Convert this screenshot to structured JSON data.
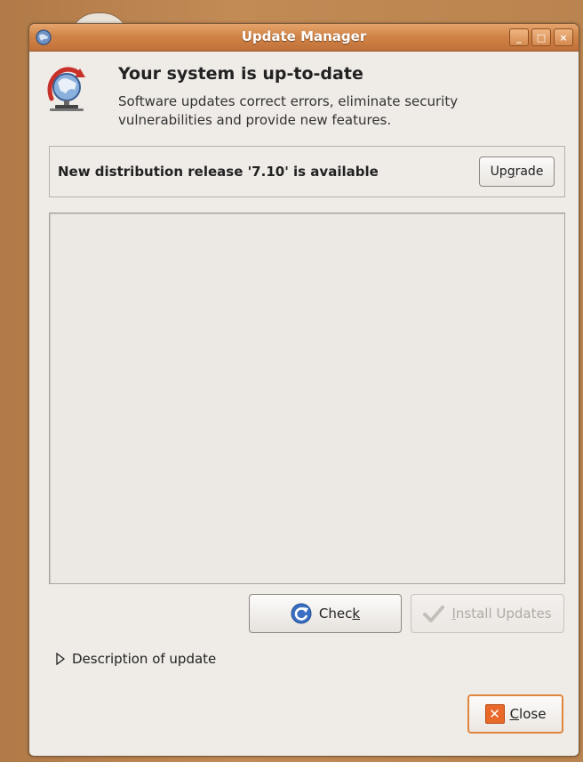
{
  "window": {
    "title": "Update Manager",
    "controls": {
      "minimize": "_",
      "maximize": "□",
      "close": "×"
    }
  },
  "header": {
    "icon": "update-manager-icon",
    "title": "Your system is up-to-date",
    "subtitle": "Software updates correct errors, eliminate security vulnerabilities and provide new features."
  },
  "release": {
    "text": "New distribution release '7.10' is available",
    "upgrade_prefix": "Up",
    "upgrade_mnemonic": "g",
    "upgrade_suffix": "rade"
  },
  "buttons": {
    "check_prefix": "Chec",
    "check_mnemonic": "k",
    "install_mnemonic": "I",
    "install_suffix": "nstall Updates",
    "close_mnemonic": "C",
    "close_suffix": "lose"
  },
  "expander": {
    "label": "Description of update",
    "expanded": false
  },
  "colors": {
    "titlebar": "#d18447",
    "accent": "#e0853c",
    "window_bg": "#efebe7"
  }
}
